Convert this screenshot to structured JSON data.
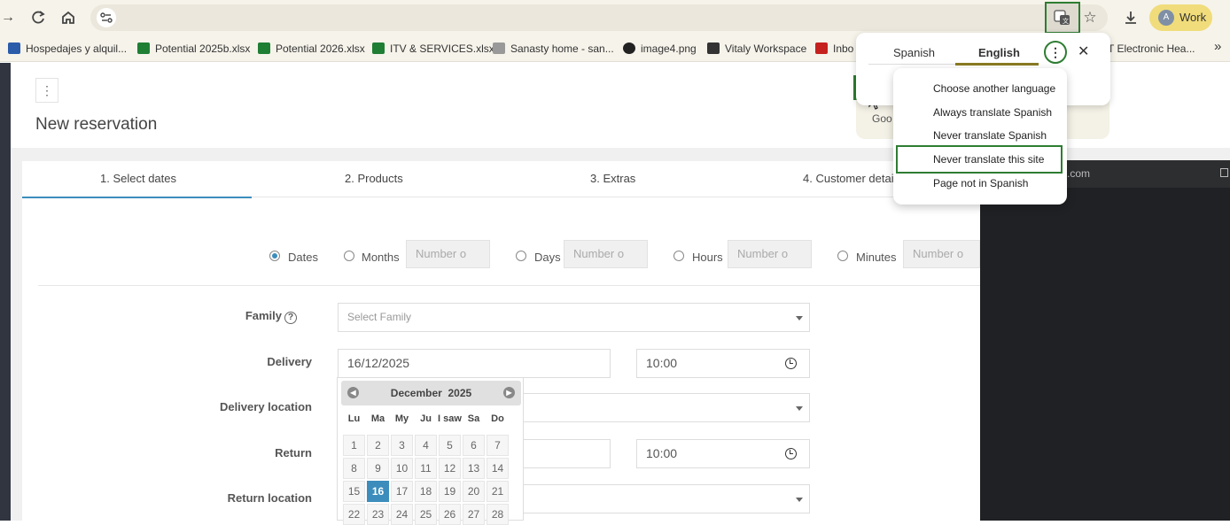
{
  "browser": {
    "profile_initial": "A",
    "profile_name": "Work",
    "bookmarks": [
      {
        "label": "Hospedajes y alquil...",
        "color": "#2a5caa"
      },
      {
        "label": "Potential 2025b.xlsx",
        "color": "#1e7e34"
      },
      {
        "label": "Potential 2026.xlsx",
        "color": "#1e7e34"
      },
      {
        "label": "ITV & SERVICES.xlsx",
        "color": "#1e7e34"
      },
      {
        "label": "Sanasty home - san...",
        "color": "#999999"
      },
      {
        "label": "image4.png",
        "color": "#222222"
      },
      {
        "label": "Vitaly Workspace",
        "color": "#333333"
      },
      {
        "label": "Inbo",
        "color": "#c5221f"
      },
      {
        "label": "T Electronic Hea...",
        "color": "#555555"
      }
    ],
    "more_bookmarks": "»"
  },
  "page": {
    "kebab": "⋮",
    "title": "New reservation",
    "tabs": [
      "1. Select dates",
      "2. Products",
      "3. Extras",
      "4. Customer detai"
    ],
    "modes": [
      {
        "label": "Dates",
        "selected": true
      },
      {
        "label": "Months",
        "selected": false,
        "placeholder": "Number o"
      },
      {
        "label": "Days",
        "selected": false,
        "placeholder": "Number o"
      },
      {
        "label": "Hours",
        "selected": false,
        "placeholder": "Number o"
      },
      {
        "label": "Minutes",
        "selected": false,
        "placeholder": "Number o"
      }
    ],
    "family_label": "Family",
    "family_help": "?",
    "family_placeholder": "Select Family",
    "delivery_label": "Delivery",
    "delivery_date": "16/12/2025",
    "delivery_time": "10:00",
    "delivery_location_label": "Delivery location",
    "return_label": "Return",
    "return_time": "10:00",
    "return_location_label": "Return location"
  },
  "calendar": {
    "month": "December",
    "year": "2025",
    "days_of_week": [
      "Lu",
      "Ma",
      "My",
      "Ju",
      "I saw",
      "Sa",
      "Do"
    ],
    "weeks": [
      [
        1,
        2,
        3,
        4,
        5,
        6,
        7
      ],
      [
        8,
        9,
        10,
        11,
        12,
        13,
        14
      ],
      [
        15,
        16,
        17,
        18,
        19,
        20,
        21
      ],
      [
        22,
        23,
        24,
        25,
        26,
        27,
        28
      ]
    ],
    "selected_day": 16
  },
  "translate": {
    "source_language": "Spanish",
    "target_language": "English",
    "menu_icon": "⋮",
    "close_icon": "✕",
    "bg_text": "Goo",
    "menu_items": [
      "Choose another language",
      "Always translate Spanish",
      "Never translate Spanish",
      "Never translate this site",
      "Page not in Spanish"
    ],
    "highlighted_item": "Never translate this site"
  },
  "dark_panel": {
    "tab_text": ".com"
  },
  "colors": {
    "accent": "#3c8dbc",
    "highlight_green": "#2e7d32",
    "toolbar": "#f6f3ea",
    "profile": "#f0dc7a"
  }
}
